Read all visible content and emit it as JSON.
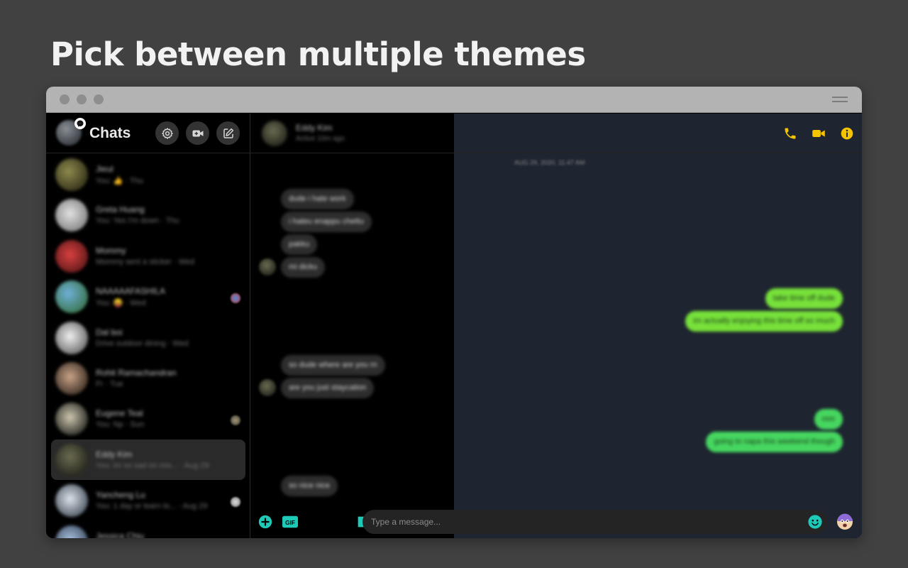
{
  "headline": "Pick between multiple themes",
  "colors": {
    "accent_yellow": "#f5c400",
    "accent_teal": "#1ec9b7",
    "bubble_lime": "#77e13a",
    "bubble_green": "#46d760",
    "chat_bg_right": "#1e2530"
  },
  "sidebar": {
    "title": "Chats",
    "buttons": [
      {
        "name": "settings",
        "icon": "gear-icon"
      },
      {
        "name": "new-video-call",
        "icon": "video-plus-icon"
      },
      {
        "name": "compose",
        "icon": "compose-icon"
      }
    ],
    "conversations": [
      {
        "name": "Jieul",
        "preview": "You: 👍 · Thu"
      },
      {
        "name": "Greta Huang",
        "preview": "You: Yes I'm down · Thu"
      },
      {
        "name": "Mommy",
        "preview": "Mommy sent a sticker · Wed"
      },
      {
        "name": "NAAAAAFASHILA",
        "preview": "You: 😝 · Wed"
      },
      {
        "name": "Dal boi",
        "preview": "Drive outdoor dining · Wed"
      },
      {
        "name": "Rohit Ramachandran",
        "preview": "Fr · Tue"
      },
      {
        "name": "Eugene Teal",
        "preview": "You: Np · Sun"
      },
      {
        "name": "Eddy Kim",
        "preview": "You: im so sad im mis... · Aug 29"
      },
      {
        "name": "Yancheng Lu",
        "preview": "You: 1 day or learn to... · Aug 29"
      },
      {
        "name": "Jessica Chiu",
        "preview": ""
      }
    ]
  },
  "chat": {
    "contact_name": "Eddy Kim",
    "contact_status": "Active 10m ago",
    "timestamp": "AUG 29, 2020, 11:47 AM",
    "incoming_group1": [
      "dude i hate work",
      "i hateu enappu chettu",
      "pakku",
      "mi dicku"
    ],
    "outgoing_group1": [
      "take time off dude",
      "im actually enjoying this time off so much"
    ],
    "incoming_group2": [
      "so dude where are you rn",
      "are you just staycation"
    ],
    "outgoing_group2": [
      "ooo",
      "going to napa this weekend though"
    ],
    "incoming_group3": [
      "so nice nice"
    ]
  },
  "composer": {
    "placeholder": "Type a message...",
    "gif_label": "GIF"
  }
}
